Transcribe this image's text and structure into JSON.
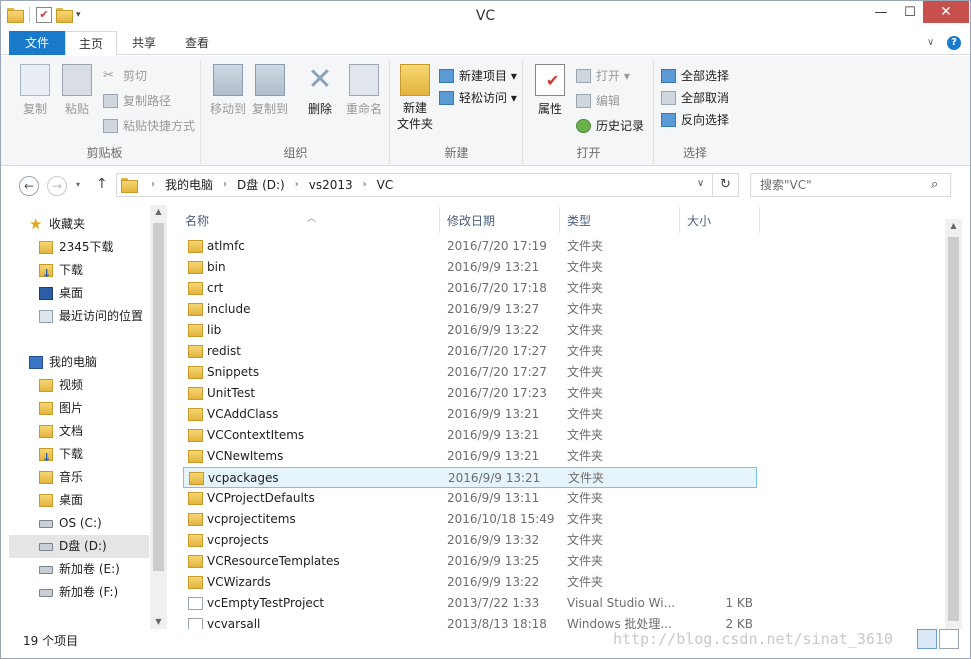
{
  "window": {
    "title": "VC"
  },
  "tabs": {
    "file": "文件",
    "home": "主页",
    "share": "共享",
    "view": "查看"
  },
  "ribbon": {
    "clipboard": {
      "label": "剪贴板",
      "copy": "复制",
      "paste": "粘贴",
      "cut": "剪切",
      "copy_path": "复制路径",
      "paste_shortcut": "粘贴快捷方式"
    },
    "organize": {
      "label": "组织",
      "move_to": "移动到",
      "copy_to": "复制到",
      "delete": "删除",
      "rename": "重命名"
    },
    "new": {
      "label": "新建",
      "new_folder": "新建\n文件夹",
      "new_item": "新建项目",
      "easy_access": "轻松访问"
    },
    "open": {
      "label": "打开",
      "properties": "属性",
      "open": "打开",
      "edit": "编辑",
      "history": "历史记录"
    },
    "select": {
      "label": "选择",
      "select_all": "全部选择",
      "select_none": "全部取消",
      "invert": "反向选择"
    }
  },
  "address": {
    "crumbs": [
      "我的电脑",
      "D盘 (D:)",
      "vs2013",
      "VC"
    ],
    "search_placeholder": "搜索\"VC\""
  },
  "nav": {
    "favorites": "收藏夹",
    "fav_items": [
      "2345下载",
      "下载",
      "桌面",
      "最近访问的位置"
    ],
    "computer": "我的电脑",
    "pc_items": [
      "视频",
      "图片",
      "文档",
      "下载",
      "音乐",
      "桌面",
      "OS (C:)",
      "D盘 (D:)",
      "新加卷 (E:)",
      "新加卷 (F:)"
    ]
  },
  "columns": {
    "name": "名称",
    "date": "修改日期",
    "type": "类型",
    "size": "大小"
  },
  "files": [
    {
      "name": "atlmfc",
      "date": "2016/7/20 17:19",
      "type": "文件夹",
      "size": ""
    },
    {
      "name": "bin",
      "date": "2016/9/9 13:21",
      "type": "文件夹",
      "size": ""
    },
    {
      "name": "crt",
      "date": "2016/7/20 17:18",
      "type": "文件夹",
      "size": ""
    },
    {
      "name": "include",
      "date": "2016/9/9 13:27",
      "type": "文件夹",
      "size": ""
    },
    {
      "name": "lib",
      "date": "2016/9/9 13:22",
      "type": "文件夹",
      "size": ""
    },
    {
      "name": "redist",
      "date": "2016/7/20 17:27",
      "type": "文件夹",
      "size": ""
    },
    {
      "name": "Snippets",
      "date": "2016/7/20 17:27",
      "type": "文件夹",
      "size": ""
    },
    {
      "name": "UnitTest",
      "date": "2016/7/20 17:23",
      "type": "文件夹",
      "size": ""
    },
    {
      "name": "VCAddClass",
      "date": "2016/9/9 13:21",
      "type": "文件夹",
      "size": ""
    },
    {
      "name": "VCContextItems",
      "date": "2016/9/9 13:21",
      "type": "文件夹",
      "size": ""
    },
    {
      "name": "VCNewItems",
      "date": "2016/9/9 13:21",
      "type": "文件夹",
      "size": ""
    },
    {
      "name": "vcpackages",
      "date": "2016/9/9 13:21",
      "type": "文件夹",
      "size": ""
    },
    {
      "name": "VCProjectDefaults",
      "date": "2016/9/9 13:11",
      "type": "文件夹",
      "size": ""
    },
    {
      "name": "vcprojectitems",
      "date": "2016/10/18 15:49",
      "type": "文件夹",
      "size": ""
    },
    {
      "name": "vcprojects",
      "date": "2016/9/9 13:32",
      "type": "文件夹",
      "size": ""
    },
    {
      "name": "VCResourceTemplates",
      "date": "2016/9/9 13:25",
      "type": "文件夹",
      "size": ""
    },
    {
      "name": "VCWizards",
      "date": "2016/9/9 13:22",
      "type": "文件夹",
      "size": ""
    },
    {
      "name": "vcEmptyTestProject",
      "date": "2013/7/22 1:33",
      "type": "Visual Studio Wi...",
      "size": "1 KB"
    },
    {
      "name": "vcvarsall",
      "date": "2013/8/13 18:18",
      "type": "Windows 批处理...",
      "size": "2 KB"
    }
  ],
  "selected_file": "vcpackages",
  "status": {
    "count": "19 个项目",
    "watermark": "http://blog.csdn.net/sinat_3610"
  }
}
